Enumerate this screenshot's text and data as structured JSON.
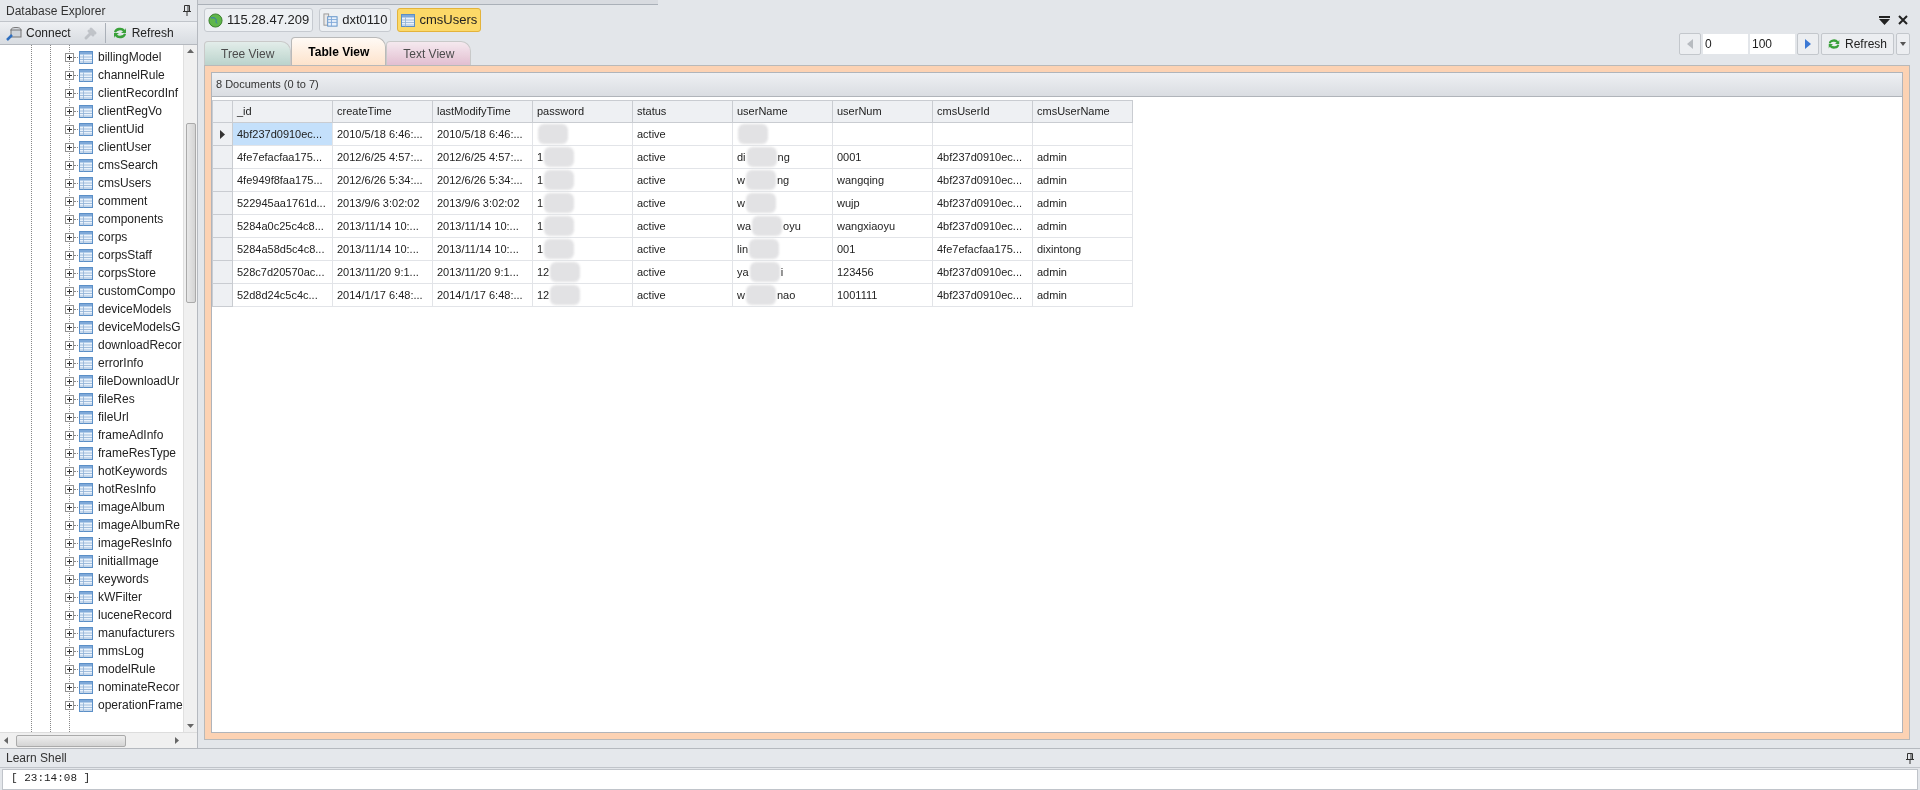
{
  "explorer": {
    "title": "Database Explorer",
    "toolbar": [
      {
        "kind": "connect",
        "label": "Connect",
        "disabled": false
      },
      {
        "kind": "disconnect",
        "disabled": true
      },
      {
        "kind": "refresh",
        "label": "Refresh",
        "disabled": false
      }
    ],
    "tree": [
      "billingModel",
      "channelRule",
      "clientRecordInf",
      "clientRegVo",
      "clientUid",
      "clientUser",
      "cmsSearch",
      "cmsUsers",
      "comment",
      "components",
      "corps",
      "corpsStaff",
      "corpsStore",
      "customCompo",
      "deviceModels",
      "deviceModelsG",
      "downloadRecor",
      "errorInfo",
      "fileDownloadUr",
      "fileRes",
      "fileUrl",
      "frameAdInfo",
      "frameResType",
      "hotKeywords",
      "hotResInfo",
      "imageAlbum",
      "imageAlbumRe",
      "imageResInfo",
      "initialImage",
      "keywords",
      "kWFilter",
      "luceneRecord",
      "manufacturers",
      "mmsLog",
      "modelRule",
      "nominateRecor",
      "operationFrame"
    ]
  },
  "breadcrumb": [
    {
      "kind": "server",
      "label": "115.28.47.209",
      "selected": false
    },
    {
      "kind": "database",
      "label": "dxt0110",
      "selected": false
    },
    {
      "kind": "collection",
      "label": "cmsUsers",
      "selected": true
    }
  ],
  "tabs": [
    {
      "label": "Tree View",
      "kind": "tree",
      "selected": false
    },
    {
      "label": "Table View",
      "kind": "table",
      "selected": true
    },
    {
      "label": "Text View",
      "kind": "text",
      "selected": false
    }
  ],
  "paging": {
    "start": "0",
    "count": "100",
    "refresh": "Refresh"
  },
  "summary": "8 Documents (0 to 7)",
  "table": {
    "columns": [
      "_id",
      "createTime",
      "lastModifyTime",
      "password",
      "status",
      "userName",
      "userNum",
      "cmsUserId",
      "cmsUserName"
    ],
    "rows": [
      {
        "selected": true,
        "cells": [
          "4bf237d0910ec...",
          "2010/5/18 6:46:...",
          "2010/5/18 6:46:...",
          {},
          "active",
          {},
          null,
          null,
          null
        ]
      },
      {
        "selected": false,
        "cells": [
          "4fe7efacfaa175...",
          "2012/6/25 4:57:...",
          "2012/6/25 4:57:...",
          {
            "before": "1"
          },
          "active",
          {
            "before": "di",
            "after": "ng"
          },
          "0001",
          "4bf237d0910ec...",
          "admin"
        ]
      },
      {
        "selected": false,
        "cells": [
          "4fe949f8faa175...",
          "2012/6/26 5:34:...",
          "2012/6/26 5:34:...",
          {
            "before": "1"
          },
          "active",
          {
            "before": "w",
            "after": "ng"
          },
          "wangqing",
          "4bf237d0910ec...",
          "admin"
        ]
      },
      {
        "selected": false,
        "cells": [
          "522945aa1761d...",
          "2013/9/6 3:02:02",
          "2013/9/6 3:02:02",
          {
            "before": "1"
          },
          "active",
          {
            "before": "w"
          },
          "wujp",
          "4bf237d0910ec...",
          "admin"
        ]
      },
      {
        "selected": false,
        "cells": [
          "5284a0c25c4c8...",
          "2013/11/14 10:...",
          "2013/11/14 10:...",
          {
            "before": "1"
          },
          "active",
          {
            "before": "wa",
            "after": "oyu"
          },
          "wangxiaoyu",
          "4bf237d0910ec...",
          "admin"
        ]
      },
      {
        "selected": false,
        "cells": [
          "5284a58d5c4c8...",
          "2013/11/14 10:...",
          "2013/11/14 10:...",
          {
            "before": "1"
          },
          "active",
          {
            "before": "lin"
          },
          "001",
          "4fe7efacfaa175...",
          "dixintong"
        ]
      },
      {
        "selected": false,
        "cells": [
          "528c7d20570ac...",
          "2013/11/20 9:1...",
          "2013/11/20 9:1...",
          {
            "before": "12"
          },
          "active",
          {
            "before": "ya",
            "after": "i"
          },
          "123456",
          "4bf237d0910ec...",
          "admin"
        ]
      },
      {
        "selected": false,
        "cells": [
          "52d8d24c5c4c...",
          "2014/1/17 6:48:...",
          "2014/1/17 6:48:...",
          {
            "before": "12"
          },
          "active",
          {
            "before": "w",
            "after": "nao"
          },
          "1001111",
          "4bf237d0910ec...",
          "admin"
        ]
      }
    ]
  },
  "shell": {
    "title": "Learn Shell",
    "output": "[ 23:14:08 ]"
  }
}
